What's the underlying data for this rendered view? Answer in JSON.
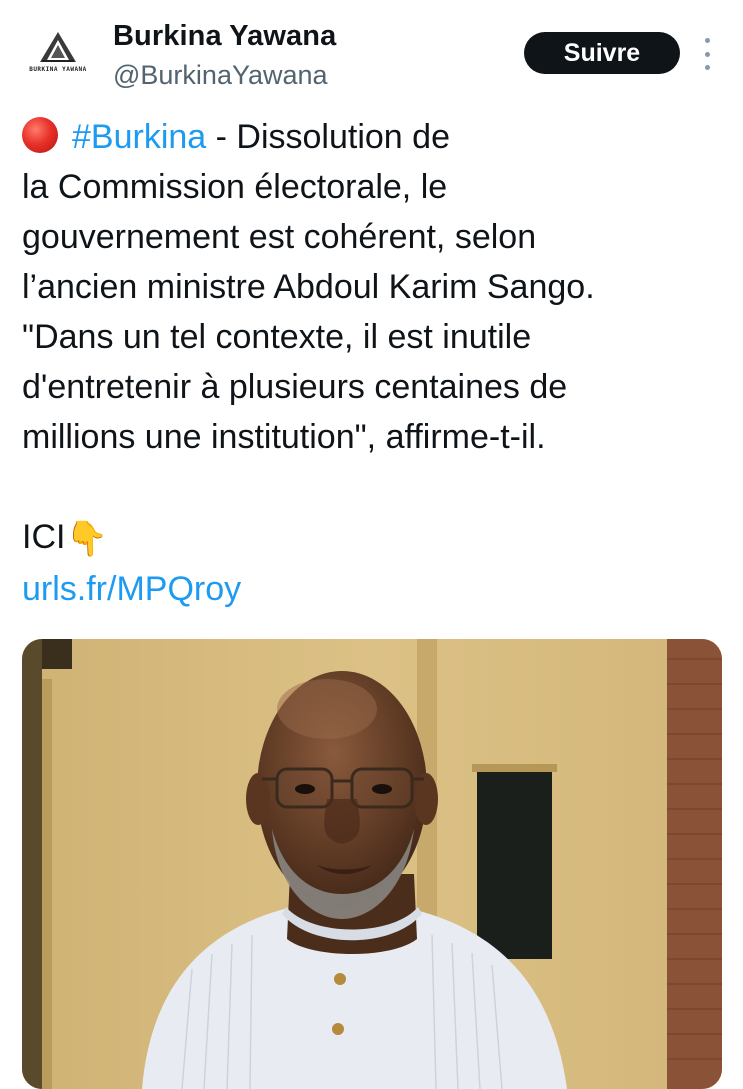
{
  "account": {
    "display_name": "Burkina Yawana",
    "handle": "@BurkinaYawana",
    "logo_text": "BURKINA YAWANA"
  },
  "actions": {
    "follow_label": "Suivre",
    "more_icon": "more-vertical-icon"
  },
  "tweet": {
    "status_icon": "red-circle-icon",
    "hashtag": "#Burkina",
    "line1_rest": " - Dissolution de",
    "lines": [
      "la Commission électorale, le",
      "gouvernement est cohérent, selon",
      "l’ancien ministre Abdoul Karim Sango.",
      "\"Dans un tel contexte, il est inutile",
      "d'entretenir à plusieurs centaines de",
      "millions une institution\", affirme-t-il."
    ],
    "cta": "ICI",
    "cta_icon": "pointing-down-icon",
    "link": "urls.fr/MPQroy"
  },
  "media": {
    "type": "photo",
    "subject": "portrait-photo"
  },
  "colors": {
    "accent": "#1d9bf0",
    "text": "#0f1419",
    "secondary": "#536471",
    "follow_bg": "#0f1419"
  }
}
